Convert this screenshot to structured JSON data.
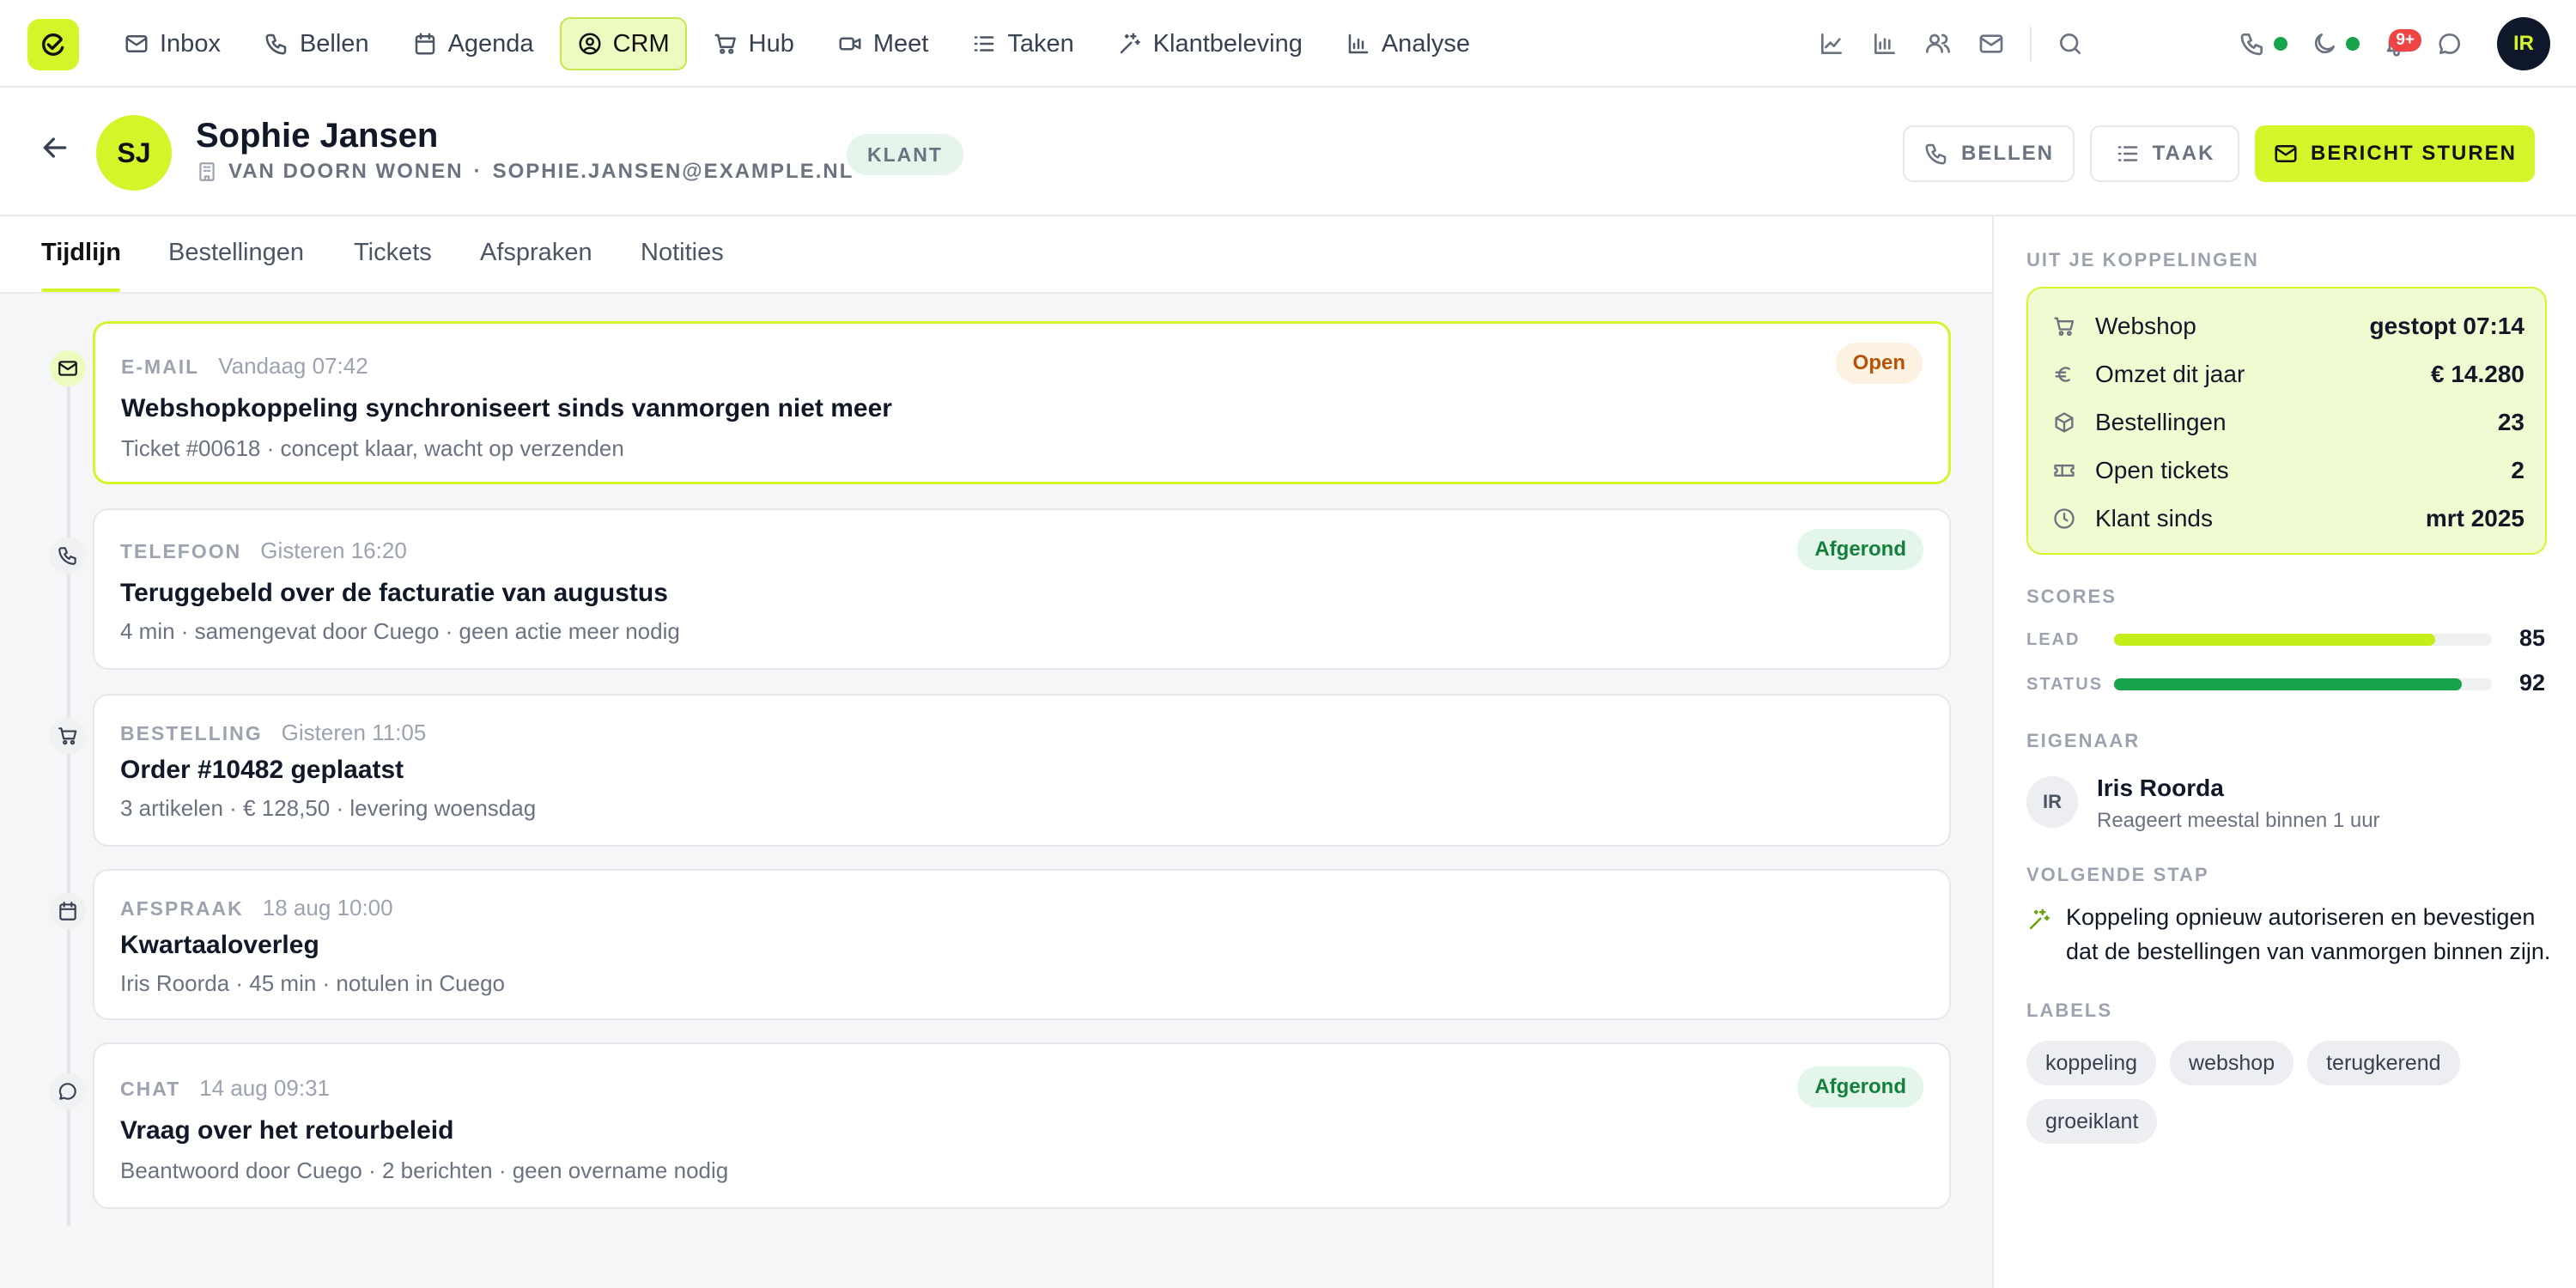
{
  "nav": {
    "items": [
      {
        "label": "Inbox",
        "icon": "mail-icon"
      },
      {
        "label": "Bellen",
        "icon": "phone-icon"
      },
      {
        "label": "Agenda",
        "icon": "calendar-icon"
      },
      {
        "label": "CRM",
        "icon": "user-circle-icon"
      },
      {
        "label": "Hub",
        "icon": "cart-icon"
      },
      {
        "label": "Meet",
        "icon": "video-icon"
      },
      {
        "label": "Taken",
        "icon": "list-icon"
      },
      {
        "label": "Klantbeleving",
        "icon": "sparkle-icon"
      },
      {
        "label": "Analyse",
        "icon": "bar-chart-icon"
      }
    ],
    "active": "CRM",
    "notifications_badge": "9+",
    "user_initials": "IR",
    "status_color": "#16a34a",
    "accent_color": "#d4f52a"
  },
  "contact": {
    "initials": "SJ",
    "name": "Sophie Jansen",
    "company": "VAN DOORN WONEN",
    "separator": "·",
    "email": "SOPHIE.JANSEN@EXAMPLE.NL",
    "badge": "KLANT"
  },
  "actions": {
    "call": "BELLEN",
    "task": "TAAK",
    "message": "BERICHT STUREN"
  },
  "tabs": [
    "Tijdlijn",
    "Bestellingen",
    "Tickets",
    "Afspraken",
    "Notities"
  ],
  "active_tab": "Tijdlijn",
  "timeline": [
    {
      "type": "E-MAIL",
      "time": "Vandaag 07:42",
      "title": "Webshopkoppeling synchroniseert sinds vanmorgen niet meer",
      "desc": "Ticket #00618 · concept klaar, wacht op verzenden",
      "status": "Open",
      "icon": "mail-icon"
    },
    {
      "type": "TELEFOON",
      "time": "Gisteren 16:20",
      "title": "Teruggebeld over de facturatie van augustus",
      "desc": "4 min · samengevat door Cuego · geen actie meer nodig",
      "status": "Afgerond",
      "icon": "phone-icon"
    },
    {
      "type": "BESTELLING",
      "time": "Gisteren 11:05",
      "title": "Order #10482 geplaatst",
      "desc": "3 artikelen · € 128,50 · levering woensdag",
      "status": "",
      "icon": "cart-icon"
    },
    {
      "type": "AFSPRAAK",
      "time": "18 aug 10:00",
      "title": "Kwartaaloverleg",
      "desc": "Iris Roorda · 45 min · notulen in Cuego",
      "status": "",
      "icon": "calendar-icon"
    },
    {
      "type": "CHAT",
      "time": "14 aug 09:31",
      "title": "Vraag over het retourbeleid",
      "desc": "Beantwoord door Cuego · 2 berichten · geen overname nodig",
      "status": "Afgerond",
      "icon": "chat-icon"
    }
  ],
  "panel": {
    "integrations_title": "UIT JE KOPPELINGEN",
    "integrations": [
      {
        "label": "Webshop",
        "value": "gestopt 07:14",
        "icon": "cart-icon"
      },
      {
        "label": "Omzet dit jaar",
        "value": "€ 14.280",
        "icon": "euro-icon"
      },
      {
        "label": "Bestellingen",
        "value": "23",
        "icon": "box-icon"
      },
      {
        "label": "Open tickets",
        "value": "2",
        "icon": "ticket-icon"
      },
      {
        "label": "Klant sinds",
        "value": "mrt 2025",
        "icon": "clock-icon"
      }
    ],
    "scores_title": "SCORES",
    "scores": [
      {
        "label": "LEAD",
        "value": 85,
        "color": "#c4ee1a"
      },
      {
        "label": "STATUS",
        "value": 92,
        "color": "#16a34a"
      }
    ],
    "owner_title": "EIGENAAR",
    "owner": {
      "initials": "IR",
      "name": "Iris Roorda",
      "note": "Reageert meestal binnen 1 uur"
    },
    "next_title": "VOLGENDE STAP",
    "next_step": "Koppeling opnieuw autoriseren en bevestigen dat de bestellingen van vanmorgen binnen zijn.",
    "labels_title": "LABELS",
    "labels": [
      "koppeling",
      "webshop",
      "terugkerend",
      "groeiklant"
    ]
  }
}
